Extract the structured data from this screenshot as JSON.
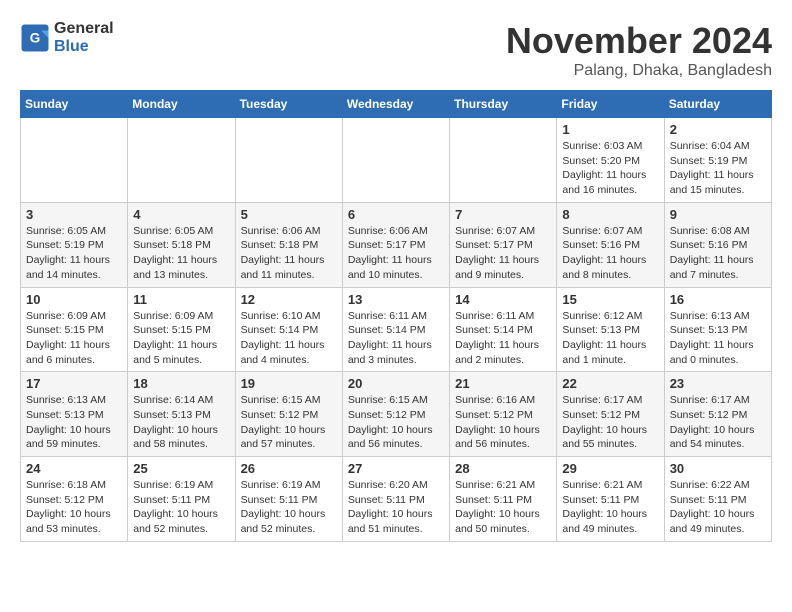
{
  "header": {
    "logo_general": "General",
    "logo_blue": "Blue",
    "month_title": "November 2024",
    "location": "Palang, Dhaka, Bangladesh"
  },
  "days_of_week": [
    "Sunday",
    "Monday",
    "Tuesday",
    "Wednesday",
    "Thursday",
    "Friday",
    "Saturday"
  ],
  "weeks": [
    [
      {
        "day": "",
        "detail": ""
      },
      {
        "day": "",
        "detail": ""
      },
      {
        "day": "",
        "detail": ""
      },
      {
        "day": "",
        "detail": ""
      },
      {
        "day": "",
        "detail": ""
      },
      {
        "day": "1",
        "detail": "Sunrise: 6:03 AM\nSunset: 5:20 PM\nDaylight: 11 hours and 16 minutes."
      },
      {
        "day": "2",
        "detail": "Sunrise: 6:04 AM\nSunset: 5:19 PM\nDaylight: 11 hours and 15 minutes."
      }
    ],
    [
      {
        "day": "3",
        "detail": "Sunrise: 6:05 AM\nSunset: 5:19 PM\nDaylight: 11 hours and 14 minutes."
      },
      {
        "day": "4",
        "detail": "Sunrise: 6:05 AM\nSunset: 5:18 PM\nDaylight: 11 hours and 13 minutes."
      },
      {
        "day": "5",
        "detail": "Sunrise: 6:06 AM\nSunset: 5:18 PM\nDaylight: 11 hours and 11 minutes."
      },
      {
        "day": "6",
        "detail": "Sunrise: 6:06 AM\nSunset: 5:17 PM\nDaylight: 11 hours and 10 minutes."
      },
      {
        "day": "7",
        "detail": "Sunrise: 6:07 AM\nSunset: 5:17 PM\nDaylight: 11 hours and 9 minutes."
      },
      {
        "day": "8",
        "detail": "Sunrise: 6:07 AM\nSunset: 5:16 PM\nDaylight: 11 hours and 8 minutes."
      },
      {
        "day": "9",
        "detail": "Sunrise: 6:08 AM\nSunset: 5:16 PM\nDaylight: 11 hours and 7 minutes."
      }
    ],
    [
      {
        "day": "10",
        "detail": "Sunrise: 6:09 AM\nSunset: 5:15 PM\nDaylight: 11 hours and 6 minutes."
      },
      {
        "day": "11",
        "detail": "Sunrise: 6:09 AM\nSunset: 5:15 PM\nDaylight: 11 hours and 5 minutes."
      },
      {
        "day": "12",
        "detail": "Sunrise: 6:10 AM\nSunset: 5:14 PM\nDaylight: 11 hours and 4 minutes."
      },
      {
        "day": "13",
        "detail": "Sunrise: 6:11 AM\nSunset: 5:14 PM\nDaylight: 11 hours and 3 minutes."
      },
      {
        "day": "14",
        "detail": "Sunrise: 6:11 AM\nSunset: 5:14 PM\nDaylight: 11 hours and 2 minutes."
      },
      {
        "day": "15",
        "detail": "Sunrise: 6:12 AM\nSunset: 5:13 PM\nDaylight: 11 hours and 1 minute."
      },
      {
        "day": "16",
        "detail": "Sunrise: 6:13 AM\nSunset: 5:13 PM\nDaylight: 11 hours and 0 minutes."
      }
    ],
    [
      {
        "day": "17",
        "detail": "Sunrise: 6:13 AM\nSunset: 5:13 PM\nDaylight: 10 hours and 59 minutes."
      },
      {
        "day": "18",
        "detail": "Sunrise: 6:14 AM\nSunset: 5:13 PM\nDaylight: 10 hours and 58 minutes."
      },
      {
        "day": "19",
        "detail": "Sunrise: 6:15 AM\nSunset: 5:12 PM\nDaylight: 10 hours and 57 minutes."
      },
      {
        "day": "20",
        "detail": "Sunrise: 6:15 AM\nSunset: 5:12 PM\nDaylight: 10 hours and 56 minutes."
      },
      {
        "day": "21",
        "detail": "Sunrise: 6:16 AM\nSunset: 5:12 PM\nDaylight: 10 hours and 56 minutes."
      },
      {
        "day": "22",
        "detail": "Sunrise: 6:17 AM\nSunset: 5:12 PM\nDaylight: 10 hours and 55 minutes."
      },
      {
        "day": "23",
        "detail": "Sunrise: 6:17 AM\nSunset: 5:12 PM\nDaylight: 10 hours and 54 minutes."
      }
    ],
    [
      {
        "day": "24",
        "detail": "Sunrise: 6:18 AM\nSunset: 5:12 PM\nDaylight: 10 hours and 53 minutes."
      },
      {
        "day": "25",
        "detail": "Sunrise: 6:19 AM\nSunset: 5:11 PM\nDaylight: 10 hours and 52 minutes."
      },
      {
        "day": "26",
        "detail": "Sunrise: 6:19 AM\nSunset: 5:11 PM\nDaylight: 10 hours and 52 minutes."
      },
      {
        "day": "27",
        "detail": "Sunrise: 6:20 AM\nSunset: 5:11 PM\nDaylight: 10 hours and 51 minutes."
      },
      {
        "day": "28",
        "detail": "Sunrise: 6:21 AM\nSunset: 5:11 PM\nDaylight: 10 hours and 50 minutes."
      },
      {
        "day": "29",
        "detail": "Sunrise: 6:21 AM\nSunset: 5:11 PM\nDaylight: 10 hours and 49 minutes."
      },
      {
        "day": "30",
        "detail": "Sunrise: 6:22 AM\nSunset: 5:11 PM\nDaylight: 10 hours and 49 minutes."
      }
    ]
  ]
}
